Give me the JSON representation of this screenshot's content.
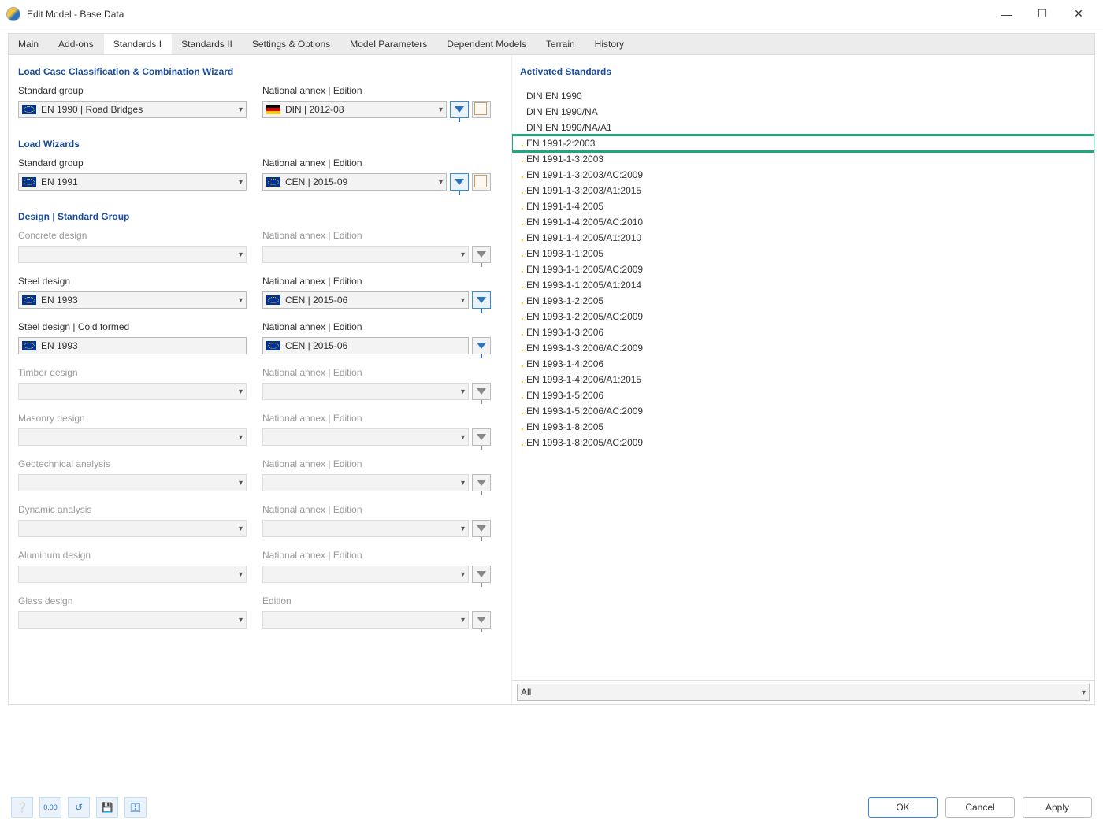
{
  "window": {
    "title": "Edit Model - Base Data"
  },
  "tabs": [
    "Main",
    "Add-ons",
    "Standards I",
    "Standards II",
    "Settings & Options",
    "Model Parameters",
    "Dependent Models",
    "Terrain",
    "History"
  ],
  "active_tab": 2,
  "sections": {
    "lccw": {
      "title": "Load Case Classification & Combination Wizard",
      "std_label": "Standard group",
      "std_value": "EN 1990 | Road Bridges",
      "std_flag": "eu",
      "annex_label": "National annex | Edition",
      "annex_value": "DIN | 2012-08",
      "annex_flag": "de"
    },
    "lw": {
      "title": "Load Wizards",
      "std_label": "Standard group",
      "std_value": "EN 1991",
      "std_flag": "eu",
      "annex_label": "National annex | Edition",
      "annex_value": "CEN | 2015-09",
      "annex_flag": "eu"
    },
    "design": {
      "title": "Design | Standard Group",
      "annex_generic_label": "National annex | Edition",
      "rows": [
        {
          "label": "Concrete design",
          "value": "",
          "annex_label": "National annex | Edition",
          "annex_value": "",
          "disabled": true,
          "flag": ""
        },
        {
          "label": "Steel design",
          "value": "EN 1993",
          "annex_label": "National annex | Edition",
          "annex_value": "CEN | 2015-06",
          "disabled": false,
          "flag": "eu",
          "filter_active": true
        },
        {
          "label": "Steel design | Cold formed",
          "value": "EN 1993",
          "annex_label": "National annex | Edition",
          "annex_value": "CEN | 2015-06",
          "disabled": false,
          "flag": "eu",
          "no_dropdown": true
        },
        {
          "label": "Timber design",
          "value": "",
          "annex_label": "National annex | Edition",
          "annex_value": "",
          "disabled": true,
          "flag": ""
        },
        {
          "label": "Masonry design",
          "value": "",
          "annex_label": "National annex | Edition",
          "annex_value": "",
          "disabled": true,
          "flag": ""
        },
        {
          "label": "Geotechnical analysis",
          "value": "",
          "annex_label": "National annex | Edition",
          "annex_value": "",
          "disabled": true,
          "flag": ""
        },
        {
          "label": "Dynamic analysis",
          "value": "",
          "annex_label": "National annex | Edition",
          "annex_value": "",
          "disabled": true,
          "flag": ""
        },
        {
          "label": "Aluminum design",
          "value": "",
          "annex_label": "National annex | Edition",
          "annex_value": "",
          "disabled": true,
          "flag": ""
        },
        {
          "label": "Glass design",
          "value": "",
          "annex_label": "Edition",
          "annex_value": "",
          "disabled": true,
          "flag": ""
        }
      ]
    }
  },
  "activated": {
    "title": "Activated Standards",
    "items": [
      {
        "flag": "de",
        "name": "DIN EN 1990"
      },
      {
        "flag": "de",
        "name": "DIN EN 1990/NA"
      },
      {
        "flag": "de",
        "name": "DIN EN 1990/NA/A1"
      },
      {
        "flag": "eu",
        "name": "EN 1991-2:2003",
        "highlight": true
      },
      {
        "flag": "eu",
        "name": "EN 1991-1-3:2003"
      },
      {
        "flag": "eu",
        "name": "EN 1991-1-3:2003/AC:2009"
      },
      {
        "flag": "eu",
        "name": "EN 1991-1-3:2003/A1:2015"
      },
      {
        "flag": "eu",
        "name": "EN 1991-1-4:2005"
      },
      {
        "flag": "eu",
        "name": "EN 1991-1-4:2005/AC:2010"
      },
      {
        "flag": "eu",
        "name": "EN 1991-1-4:2005/A1:2010"
      },
      {
        "flag": "eu",
        "name": "EN 1993-1-1:2005"
      },
      {
        "flag": "eu",
        "name": "EN 1993-1-1:2005/AC:2009"
      },
      {
        "flag": "eu",
        "name": "EN 1993-1-1:2005/A1:2014"
      },
      {
        "flag": "eu",
        "name": "EN 1993-1-2:2005"
      },
      {
        "flag": "eu",
        "name": "EN 1993-1-2:2005/AC:2009"
      },
      {
        "flag": "eu",
        "name": "EN 1993-1-3:2006"
      },
      {
        "flag": "eu",
        "name": "EN 1993-1-3:2006/AC:2009"
      },
      {
        "flag": "eu",
        "name": "EN 1993-1-4:2006"
      },
      {
        "flag": "eu",
        "name": "EN 1993-1-4:2006/A1:2015"
      },
      {
        "flag": "eu",
        "name": "EN 1993-1-5:2006"
      },
      {
        "flag": "eu",
        "name": "EN 1993-1-5:2006/AC:2009"
      },
      {
        "flag": "eu",
        "name": "EN 1993-1-8:2005"
      },
      {
        "flag": "eu",
        "name": "EN 1993-1-8:2005/AC:2009"
      }
    ],
    "filter": "All"
  },
  "footer": {
    "ok": "OK",
    "cancel": "Cancel",
    "apply": "Apply"
  }
}
